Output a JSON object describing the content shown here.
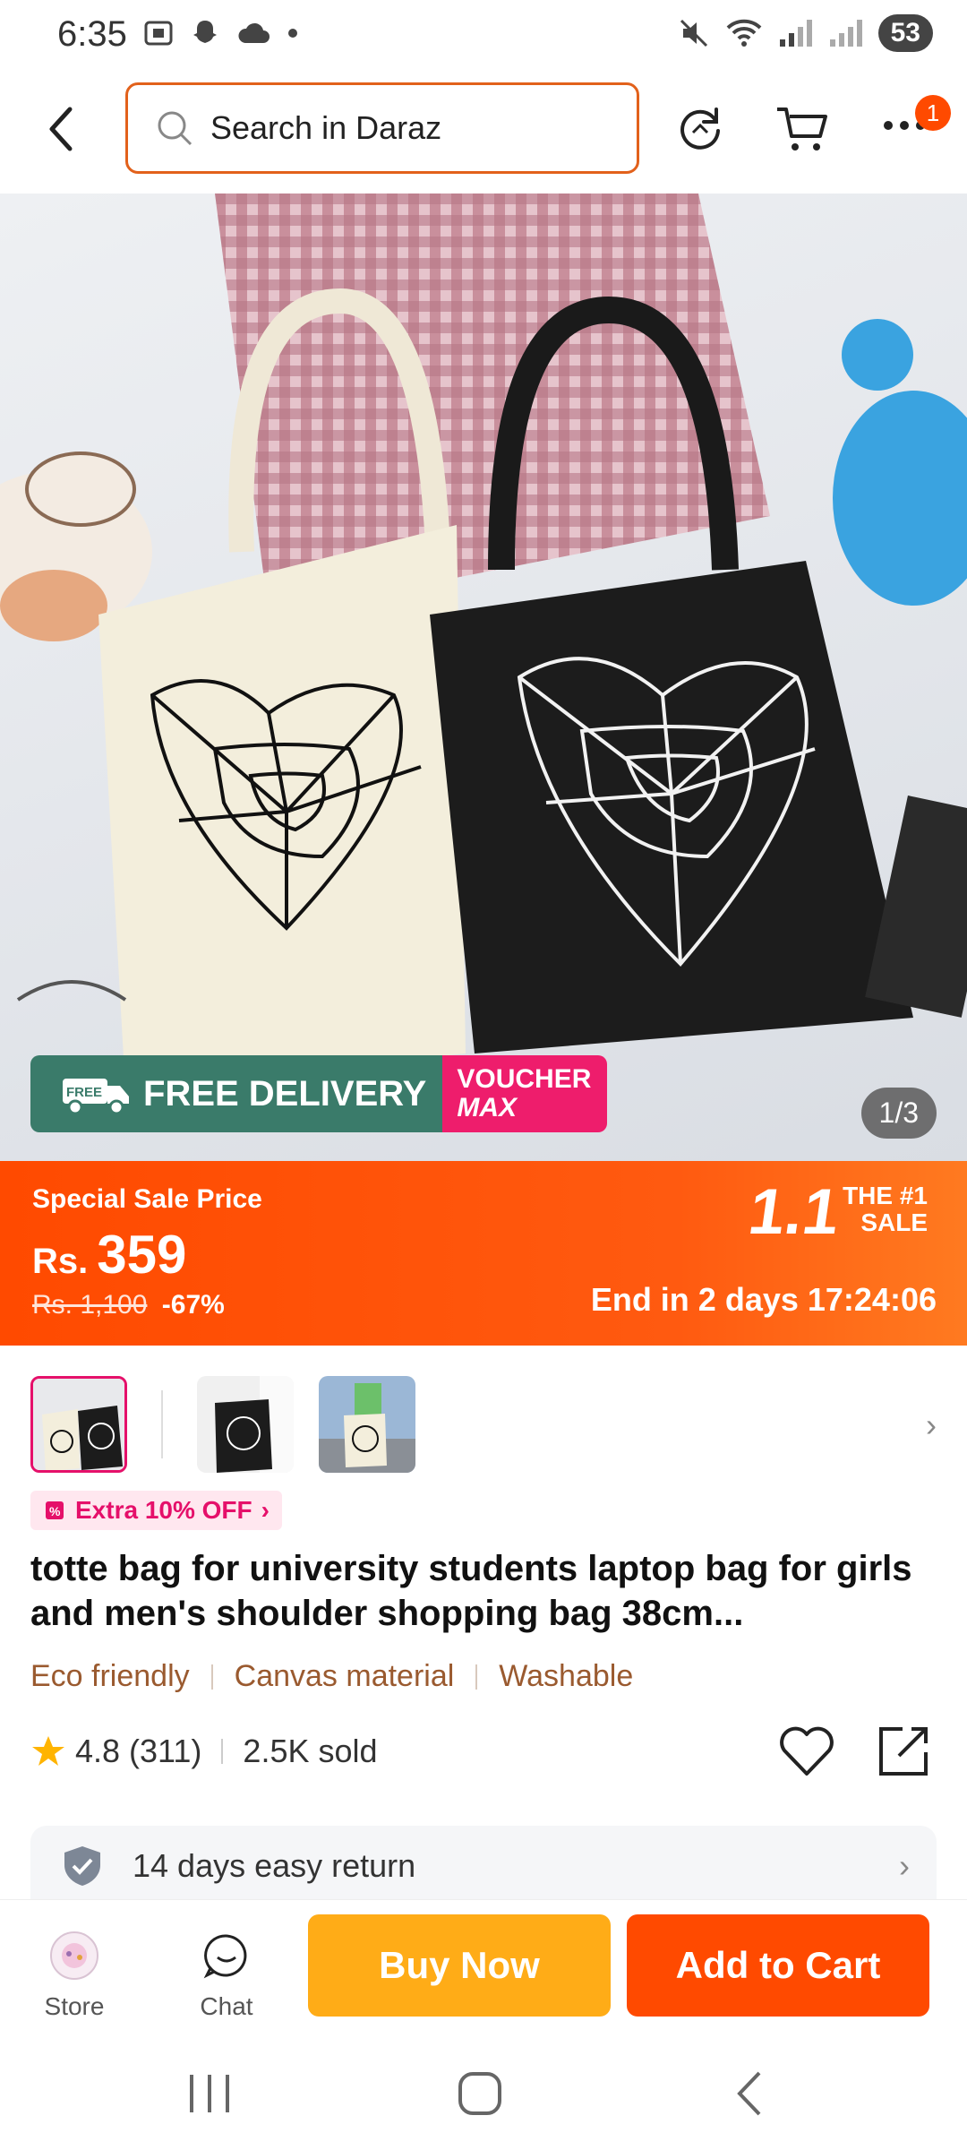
{
  "status_bar": {
    "time": "6:35",
    "battery": "53"
  },
  "search": {
    "placeholder": "Search in Daraz"
  },
  "header": {
    "menu_badge": "1"
  },
  "gallery": {
    "counter": "1/3",
    "promo_free_badge": "FREE",
    "promo_free_delivery": "FREE DELIVERY",
    "promo_voucher_line1": "VOUCHER",
    "promo_voucher_line2": "MAX"
  },
  "sale": {
    "label": "Special Sale Price",
    "currency": "Rs.",
    "price": "359",
    "old_price": "Rs. 1,100",
    "discount": "-67%",
    "logo_big": "1.1",
    "logo_small_1": "THE #1",
    "logo_small_2": "SALE",
    "ends": "End in 2 days 17:24:06"
  },
  "promo": {
    "extra_off": "Extra 10% OFF"
  },
  "product": {
    "title": "totte bag for university students laptop bag for girls and men's shoulder shopping bag 38cm...",
    "tags": [
      "Eco friendly",
      "Canvas material",
      "Washable"
    ],
    "rating": "4.8",
    "reviews": "(311)",
    "sold": "2.5K sold"
  },
  "service": {
    "return_policy": "14 days easy return"
  },
  "actions": {
    "store": "Store",
    "chat": "Chat",
    "buy_now": "Buy Now",
    "add_to_cart": "Add to Cart"
  },
  "colors": {
    "brand_orange": "#ff4a00",
    "buy_yellow": "#ffac17",
    "pink": "#e5106a"
  }
}
